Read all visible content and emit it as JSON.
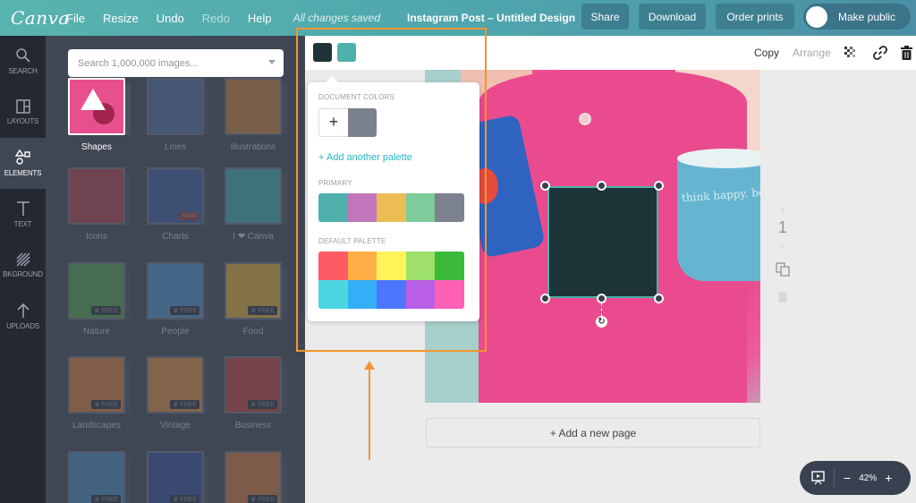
{
  "topbar": {
    "logo": "Canva",
    "menu": [
      {
        "label": "File",
        "enabled": true
      },
      {
        "label": "Resize",
        "enabled": true
      },
      {
        "label": "Undo",
        "enabled": true
      },
      {
        "label": "Redo",
        "enabled": false
      },
      {
        "label": "Help",
        "enabled": true
      }
    ],
    "save_status": "All changes saved",
    "document_title": "Instagram Post – Untitled Design",
    "share_label": "Share",
    "download_label": "Download",
    "order_prints_label": "Order prints",
    "make_public_label": "Make public",
    "make_public_on": false
  },
  "rail": {
    "items": [
      {
        "label": "SEARCH",
        "icon": "search-icon",
        "glyph": "⚲"
      },
      {
        "label": "LAYOUTS",
        "icon": "layouts-icon",
        "glyph": "◫"
      },
      {
        "label": "ELEMENTS",
        "icon": "elements-icon",
        "glyph": "△▫",
        "active": true
      },
      {
        "label": "TEXT",
        "icon": "text-icon",
        "glyph": "T"
      },
      {
        "label": "BKGROUND",
        "icon": "background-icon",
        "glyph": "▨"
      },
      {
        "label": "UPLOADS",
        "icon": "upload-icon",
        "glyph": "↑"
      }
    ]
  },
  "panel": {
    "search_placeholder": "Search 1,000,000 images...",
    "free_badge": "FREE",
    "new_badge": "NEW",
    "tiles": [
      {
        "label": "Shapes",
        "color": "#e8508d",
        "active": true
      },
      {
        "label": "Lines",
        "color": "#4d6d9a"
      },
      {
        "label": "Illustrations",
        "color": "#c17e3a"
      },
      {
        "label": "Icons",
        "color": "#a9434c"
      },
      {
        "label": "Charts",
        "color": "#3e5d9a",
        "badge": "NEW"
      },
      {
        "label": "I ❤ Canva",
        "color": "#3ea9a8"
      },
      {
        "label": "Nature",
        "color": "#4f9a4e",
        "badge": "FREE"
      },
      {
        "label": "People",
        "color": "#4f8ec6",
        "badge": "FREE"
      },
      {
        "label": "Food",
        "color": "#d6a93a",
        "badge": "FREE"
      },
      {
        "label": "Landscapes",
        "color": "#cf7a3a",
        "badge": "FREE"
      },
      {
        "label": "Vintage",
        "color": "#d7873e",
        "badge": "FREE"
      },
      {
        "label": "Business",
        "color": "#b9423f",
        "badge": "FREE"
      },
      {
        "label": "",
        "color": "#4a86b9",
        "badge": "FREE"
      },
      {
        "label": "",
        "color": "#34509a",
        "badge": "FREE"
      },
      {
        "label": "",
        "color": "#c9763f",
        "badge": "FREE"
      }
    ]
  },
  "toolbar": {
    "selected_fill": "#1c3438",
    "selected_border": "#4fb1ac",
    "copy_label": "Copy",
    "arrange_label": "Arrange",
    "arrange_enabled": false
  },
  "color_popup": {
    "document_colors_label": "DOCUMENT COLORS",
    "document_colors": [
      "#7b808d"
    ],
    "add_palette_label": "+ Add another palette",
    "primary_label": "PRIMARY",
    "primary_colors": [
      "#4fb1ac",
      "#c276bc",
      "#ecbc55",
      "#7ecc9b",
      "#7d8291"
    ],
    "default_label": "DEFAULT PALETTE",
    "default_colors_row1": [
      "#ff5b64",
      "#ffaf46",
      "#fff35a",
      "#9ee06a",
      "#3cb93a"
    ],
    "default_colors_row2": [
      "#4bd6e2",
      "#34aef7",
      "#4c76fb",
      "#b85fe6",
      "#ff60b5"
    ]
  },
  "canvas": {
    "mug_text": "think happy. be",
    "add_page_label": "+ Add a new page",
    "page_number": "1"
  },
  "zoom": {
    "level": "42%",
    "minus": "−",
    "plus": "+"
  },
  "annotation": {
    "color": "#f3952d"
  }
}
